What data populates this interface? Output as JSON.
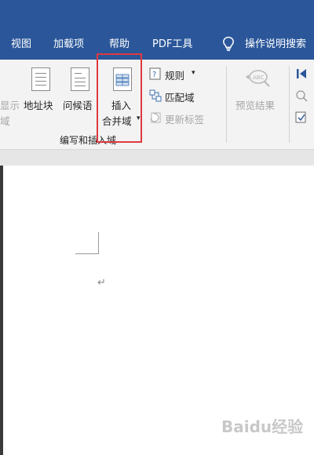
{
  "tabs": {
    "view": "视图",
    "addins": "加载项",
    "help": "帮助",
    "pdf": "PDF工具",
    "tellme": "操作说明搜索"
  },
  "ribbon": {
    "highlight_label": "显示",
    "highlight_label2": "域",
    "address_block": "地址块",
    "greeting_line": "问候语",
    "insert_merge_field_1": "插入",
    "insert_merge_field_2": "合并域",
    "rules": "规则",
    "match_fields": "匹配域",
    "update_labels": "更新标签",
    "group_label": "编写和插入域",
    "preview_results": "预览结果"
  },
  "document": {
    "para_mark": "↵"
  },
  "watermark": "Baidu经验",
  "colors": {
    "ribbon_blue": "#2b579a",
    "highlight_red": "#e0393e",
    "ribbon_bg": "#f3f3f3"
  }
}
